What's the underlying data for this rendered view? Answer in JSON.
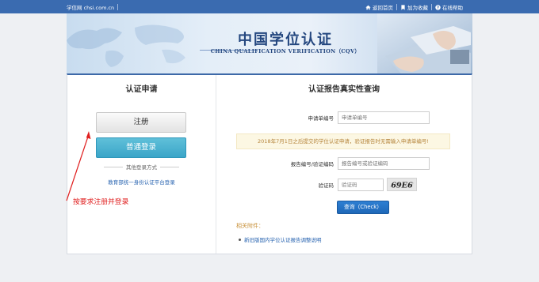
{
  "topbar": {
    "site": "学信网 chsi.com.cn",
    "links": [
      {
        "icon": "home-icon",
        "label": "返回首页"
      },
      {
        "icon": "bookmark-icon",
        "label": "加为收藏"
      },
      {
        "icon": "help-icon",
        "label": "在线帮助"
      }
    ]
  },
  "banner": {
    "title_cn": "中国学位认证",
    "title_en": "CHINA QUALIFICATION VERIFICATION（CQV）"
  },
  "left": {
    "title": "认证申请",
    "register_label": "注册",
    "login_label": "普通登录",
    "other_login": "其他登录方式",
    "edu_link": "教育部统一身份认证平台登录"
  },
  "right": {
    "title": "认证报告真实性查询",
    "app_no_label": "申请单编号",
    "app_no_placeholder": "申请单编号",
    "notice": "2018年7月1日之后提交的学位认证申请，验证报告时无需输入申请单编号!",
    "report_label": "报告编号/验证编码",
    "report_placeholder": "报告编号或验证编码",
    "code_label": "验证码",
    "code_placeholder": "验证码",
    "captcha_text": "69E6",
    "check_label": "查询（Check）",
    "attach_title": "相关附件：",
    "attach_link": "新旧版国内学位认证报告调整说明"
  },
  "annotation": {
    "text": "按要求注册并登录"
  },
  "colors": {
    "topbar": "#3a6bb0",
    "login_button": "#3ba5c8",
    "check_button": "#1f68b8",
    "annotation": "#e02020"
  }
}
